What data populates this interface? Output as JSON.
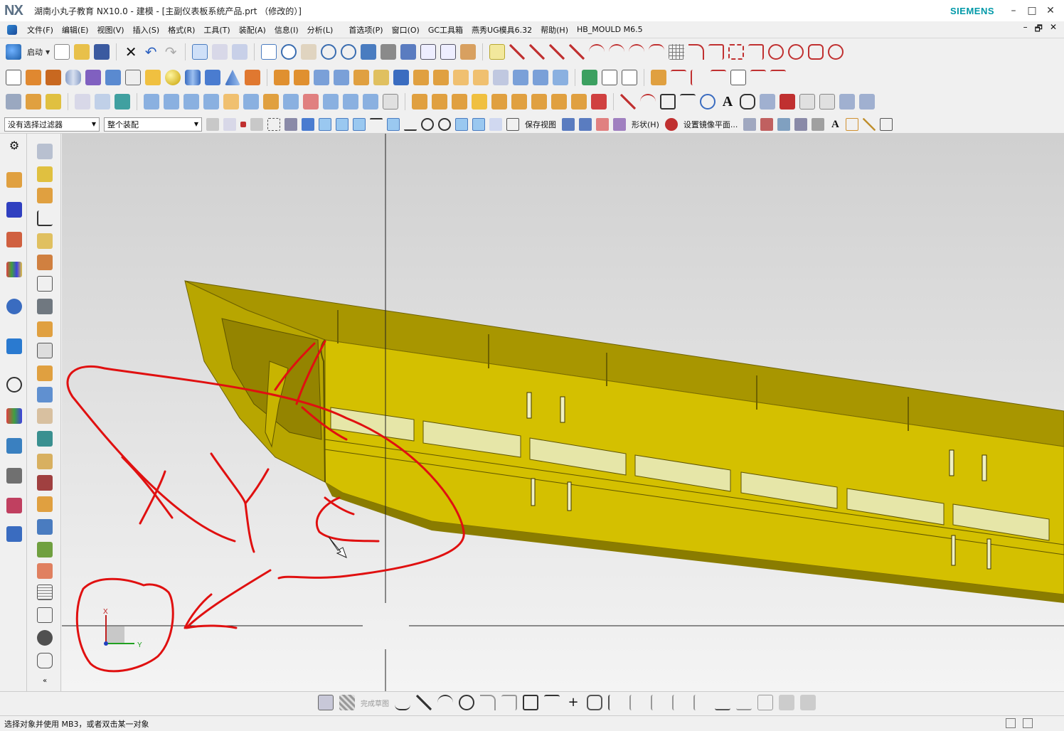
{
  "window": {
    "logo": "NX",
    "title": "湖南小丸子教育 NX10.0 - 建模 - [主副仪表板系统产品.prt （修改的）]",
    "brand": "SIEMENS",
    "minimize": "–",
    "maximize": "□",
    "close": "✕"
  },
  "menu": {
    "items": [
      "文件(F)",
      "编辑(E)",
      "视图(V)",
      "插入(S)",
      "格式(R)",
      "工具(T)",
      "装配(A)",
      "信息(I)",
      "分析(L)",
      "首选项(P)",
      "窗口(O)",
      "GC工具箱",
      "燕秀UG模具6.32",
      "帮助(H)",
      "HB_MOULD M6.5"
    ],
    "right": [
      "–",
      "🗗",
      "✕"
    ]
  },
  "toolbar": {
    "start_label": "启动",
    "save_view_label": "保存视图",
    "shape_label": "形状(H)",
    "mirror_plane_label": "设置镜像平面..."
  },
  "selection": {
    "filter": "没有选择过滤器",
    "scope": "整个装配"
  },
  "sketch_bar": {
    "finish_label": "完成草图"
  },
  "status": {
    "prompt": "选择对象并使用 MB3，或者双击某一对象"
  },
  "axes": {
    "x": "X",
    "y": "Y"
  },
  "colors": {
    "part_yellow": "#d4c000",
    "part_dark": "#9a8a00",
    "annotation_red": "#e01010",
    "brand_teal": "#0099a8"
  }
}
